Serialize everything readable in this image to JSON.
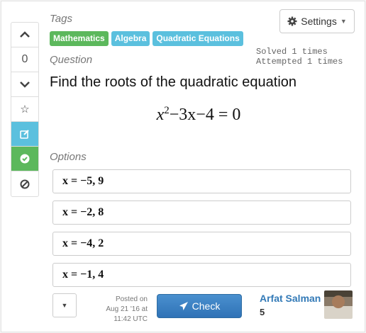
{
  "vote": {
    "count": "0"
  },
  "tags": {
    "label": "Tags",
    "items": [
      {
        "text": "Mathematics",
        "color": "green"
      },
      {
        "text": "Algebra",
        "color": "blue"
      },
      {
        "text": "Quadratic Equations",
        "color": "blue"
      }
    ]
  },
  "settings": {
    "label": "Settings"
  },
  "stats": {
    "solved": "Solved 1 times",
    "attempted": "Attempted 1 times"
  },
  "question": {
    "label": "Question",
    "text": "Find the roots of the quadratic equation",
    "equation": {
      "var": "x",
      "exp": "2",
      "rest": "−3x−4 = 0"
    }
  },
  "options": {
    "label": "Options",
    "items": [
      "x = −5, 9",
      "x = −2, 8",
      "x = −4, 2",
      "x = −1, 4"
    ]
  },
  "footer": {
    "posted_line1": "Posted on",
    "posted_line2": "Aug 21 '16 at",
    "posted_line3": "11:42 UTC",
    "check_label": "Check",
    "author_name": "Arfat Salman",
    "author_score": "5"
  },
  "colors": {
    "green": "#5cb85c",
    "blue": "#5bc0de",
    "primary": "#337ab7"
  },
  "icons": [
    "chevron-up-icon",
    "chevron-down-icon",
    "star-icon",
    "edit-icon",
    "check-circle-icon",
    "ban-icon",
    "gear-icon",
    "caret-down-icon",
    "send-icon"
  ]
}
